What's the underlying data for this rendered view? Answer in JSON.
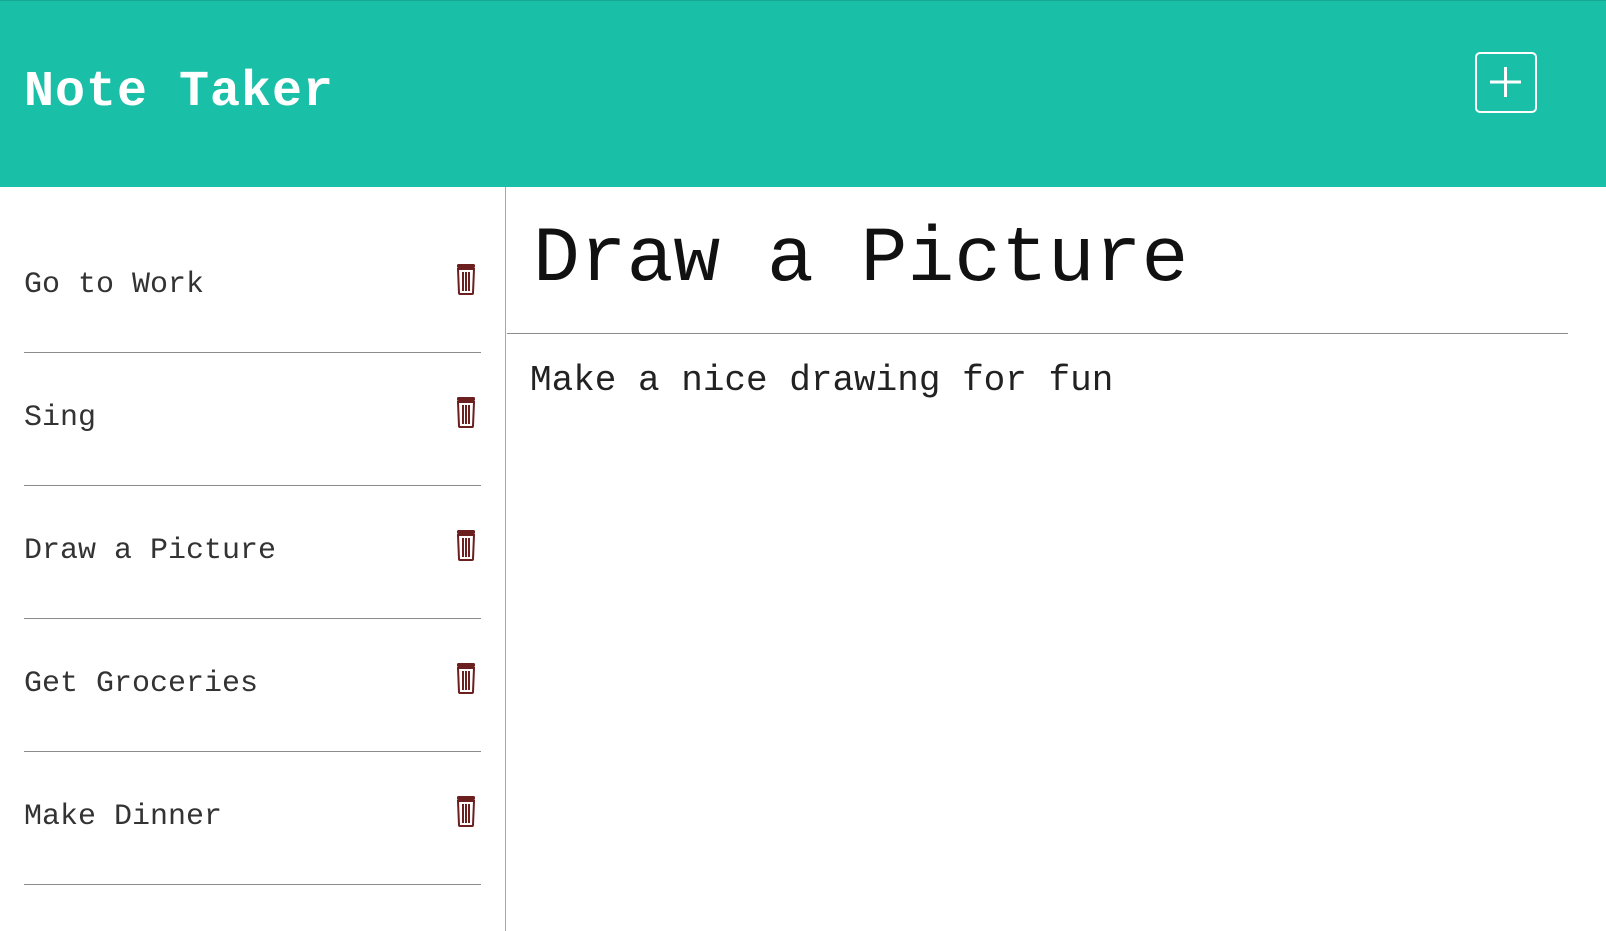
{
  "header": {
    "title": "Note Taker",
    "new_note_icon": "plus-square-icon"
  },
  "sidebar": {
    "notes": [
      {
        "title": "Go to Work",
        "icon": "trash-icon"
      },
      {
        "title": "Sing",
        "icon": "trash-icon"
      },
      {
        "title": "Draw a Picture",
        "icon": "trash-icon"
      },
      {
        "title": "Get Groceries",
        "icon": "trash-icon"
      },
      {
        "title": "Make Dinner",
        "icon": "trash-icon"
      }
    ]
  },
  "editor": {
    "title": "Draw a Picture",
    "body": "Make a nice drawing for fun"
  },
  "colors": {
    "navbar": "#1abfa8",
    "trash_icon": "#6b1f1f"
  }
}
